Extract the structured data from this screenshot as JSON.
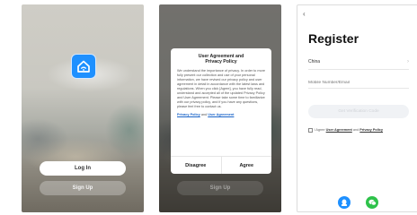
{
  "screen1": {
    "app_icon": "home-wifi-icon",
    "login_label": "Log In",
    "signup_label": "Sign Up"
  },
  "screen2": {
    "dialog_title": "User Agreement and Privacy Policy",
    "dialog_body": "We understand the importance of privacy. In order to more fully present our collection and use of your personal information, we have revised our privacy policy and user agreement in detail in accordance with the latest laws and regulations. When you click [Agree], you have fully read, understand and accepted all of the updated Privacy Policy and User Agreement. Please take some time to familiarize with our privacy policy, and if you have any questions, please feel free to contact us.",
    "privacy_link": "Privacy Policy",
    "and_text": "and",
    "agreement_link": "User Agreement",
    "disagree_label": "Disagree",
    "agree_label": "Agree",
    "background_signup_label": "Sign Up"
  },
  "screen3": {
    "back_icon": "chevron-left-icon",
    "title": "Register",
    "country": "China",
    "mobile_placeholder": "Mobile Number/Email",
    "code_button": "Get Verification Code",
    "agree_prefix": "I Agree",
    "agreement_link": "User Agreement",
    "and_text": "and",
    "privacy_link": "Privacy Policy",
    "social_icons": [
      "qq-icon",
      "wechat-icon"
    ]
  },
  "colors": {
    "accent_blue": "#1e90ff",
    "wechat_green": "#2ec24a",
    "link_blue": "#1a64c8"
  }
}
